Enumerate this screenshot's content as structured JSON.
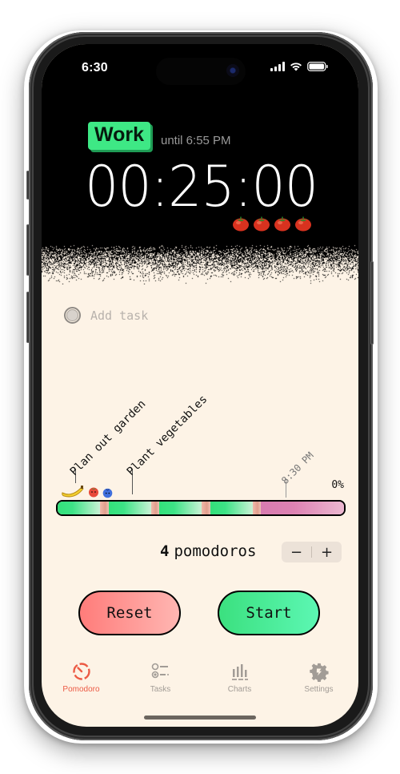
{
  "status_bar": {
    "time": "6:30"
  },
  "timer": {
    "mode": "Work",
    "until": "until 6:55 PM",
    "remaining": "00:25:00",
    "tomato_count": 4,
    "colors": {
      "mode_badge": "#3ee885",
      "timer_text": "#ffffff"
    }
  },
  "add_task": {
    "label": "Add task"
  },
  "timeline": {
    "tasks": [
      {
        "label": "Plan out garden"
      },
      {
        "label": "Plant vegetables"
      }
    ],
    "end_time": "8:30 PM",
    "progress_label": "0%",
    "progress": 0,
    "segments": [
      "work",
      "break",
      "work",
      "break",
      "work",
      "break",
      "work",
      "break",
      "long-break"
    ]
  },
  "pomodoros": {
    "count": "4",
    "label": "pomodoros",
    "decrement": "−",
    "increment": "+"
  },
  "actions": {
    "reset": "Reset",
    "start": "Start"
  },
  "tabs": [
    {
      "label": "Pomodoro",
      "icon": "timer-icon",
      "active": true
    },
    {
      "label": "Tasks",
      "icon": "task-list-icon",
      "active": false
    },
    {
      "label": "Charts",
      "icon": "chart-icon",
      "active": false
    },
    {
      "label": "Settings",
      "icon": "gear-icon",
      "active": false
    }
  ],
  "colors": {
    "accent": "#ec5a44",
    "background": "#fdf3e6",
    "work": "#3de386",
    "long_break": "#d87bb0"
  }
}
